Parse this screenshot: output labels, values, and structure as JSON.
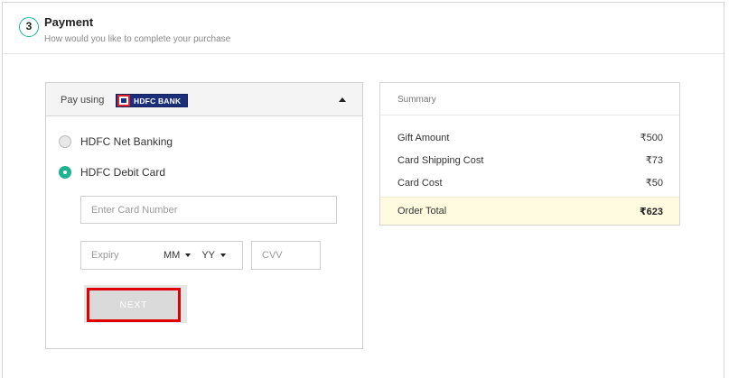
{
  "header": {
    "step_number": "3",
    "title": "Payment",
    "subtitle": "How would you like to complete your purchase"
  },
  "payment": {
    "pay_using_label": "Pay using",
    "bank_logo_text": "HDFC BANK",
    "options": [
      {
        "label": "HDFC Net Banking",
        "selected": false
      },
      {
        "label": "HDFC Debit Card",
        "selected": true
      }
    ],
    "card_number_placeholder": "Enter Card Number",
    "expiry_label": "Expiry",
    "month_value": "MM",
    "year_value": "YY",
    "cvv_placeholder": "CVV",
    "next_label": "NEXT"
  },
  "summary": {
    "title": "Summary",
    "rows": [
      {
        "label": "Gift Amount",
        "value": "₹500"
      },
      {
        "label": "Card Shipping Cost",
        "value": "₹73"
      },
      {
        "label": "Card Cost",
        "value": "₹50"
      }
    ],
    "total": {
      "label": "Order Total",
      "value": "₹623"
    }
  },
  "colors": {
    "accent": "#1cb393",
    "highlight_border": "#e00000",
    "total_bg": "#fffbe0",
    "bank_blue": "#1b2e7a",
    "bank_red": "#d9232d"
  }
}
